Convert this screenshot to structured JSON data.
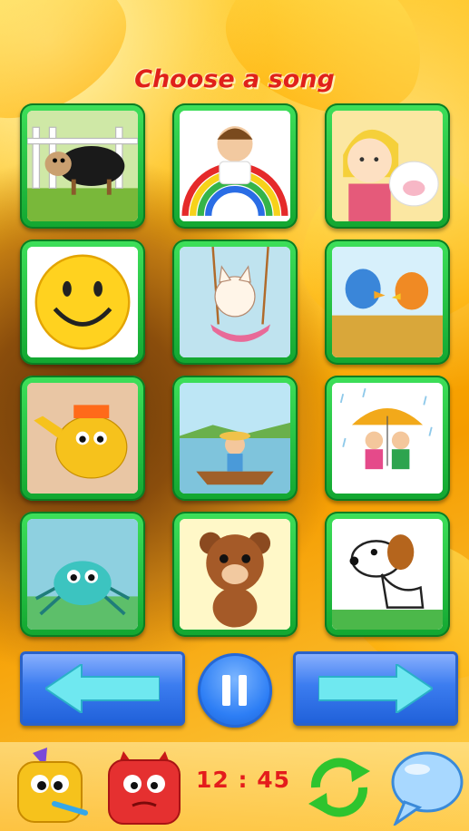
{
  "header": {
    "title": "Choose a song"
  },
  "songs": [
    {
      "icon": "black-sheep-icon"
    },
    {
      "icon": "child-painting-icon"
    },
    {
      "icon": "mary-lamb-icon"
    },
    {
      "icon": "smiley-face-icon"
    },
    {
      "icon": "kitten-swing-icon"
    },
    {
      "icon": "bluebirds-icon"
    },
    {
      "icon": "teapot-icon"
    },
    {
      "icon": "boy-rowing-boat-icon"
    },
    {
      "icon": "kids-umbrella-rain-icon"
    },
    {
      "icon": "spider-icon"
    },
    {
      "icon": "teddy-bear-icon"
    },
    {
      "icon": "puppy-dog-icon"
    }
  ],
  "controls": {
    "prev_icon": "arrow-left-icon",
    "pause_icon": "pause-icon",
    "next_icon": "arrow-right-icon"
  },
  "footer": {
    "clock": "12 : 45",
    "left_icon": "party-character-icon",
    "devil_icon": "red-monster-icon",
    "refresh_icon": "refresh-icon",
    "chat_icon": "speech-bubble-icon"
  },
  "colors": {
    "title": "#e0201a",
    "tile_frame": "#22c040",
    "button_blue": "#3c7df0",
    "clock": "#e41c1c"
  }
}
